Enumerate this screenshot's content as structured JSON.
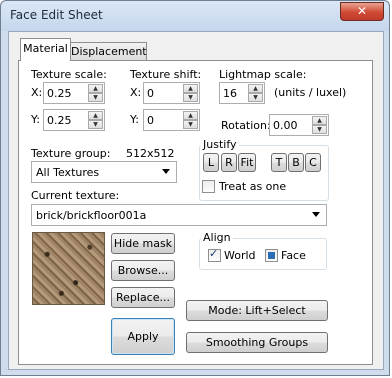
{
  "window": {
    "title": "Face Edit Sheet",
    "close_glyph": "✕"
  },
  "tabs": [
    {
      "label": "Material"
    },
    {
      "label": "Displacement"
    }
  ],
  "texture_scale": {
    "label": "Texture scale:",
    "x_label": "X:",
    "x_value": "0.25",
    "y_label": "Y:",
    "y_value": "0.25"
  },
  "texture_shift": {
    "label": "Texture shift:",
    "x_label": "X:",
    "x_value": "0",
    "y_label": "Y:",
    "y_value": "0"
  },
  "lightmap_scale": {
    "label": "Lightmap scale:",
    "value": "16",
    "units": "(units / luxel)"
  },
  "rotation": {
    "label": "Rotation:",
    "value": "0.00"
  },
  "texture_group": {
    "label": "Texture group:",
    "size": "512x512",
    "selected": "All Textures"
  },
  "justify": {
    "label": "Justify",
    "buttons": [
      "L",
      "R",
      "Fit",
      "T",
      "B",
      "C"
    ],
    "treat_as_one": "Treat as one",
    "treat_as_one_checked": false
  },
  "current_texture": {
    "label": "Current texture:",
    "value": "brick/brickfloor001a"
  },
  "buttons": {
    "hide_mask": "Hide mask",
    "browse": "Browse...",
    "replace": "Replace...",
    "apply": "Apply",
    "mode": "Mode: Lift+Select",
    "smoothing": "Smoothing Groups"
  },
  "align": {
    "label": "Align",
    "world": "World",
    "world_checked": true,
    "face": "Face",
    "face_checked": false
  },
  "icons": {
    "spin_up": "▲",
    "spin_down": "▼",
    "check": "✓"
  },
  "colors": {
    "accent": "#1e3f74",
    "window_frame": "#cfdcec"
  }
}
